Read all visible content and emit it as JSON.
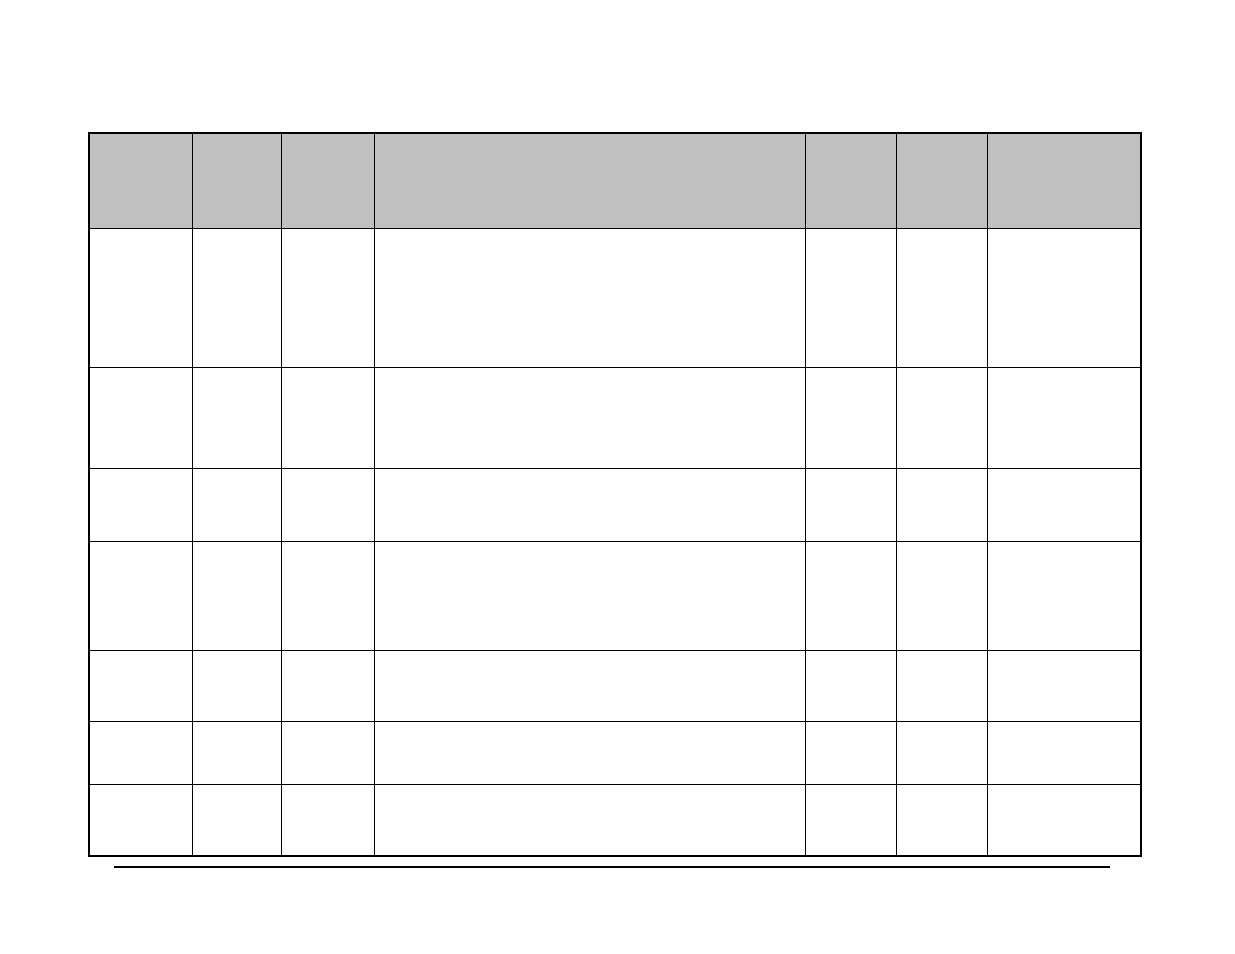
{
  "table": {
    "headers": [
      "",
      "",
      "",
      "",
      "",
      "",
      ""
    ],
    "rows": [
      [
        "",
        "",
        "",
        "",
        "",
        "",
        ""
      ],
      [
        "",
        "",
        "",
        "",
        "",
        "",
        ""
      ],
      [
        "",
        "",
        "",
        "",
        "",
        "",
        ""
      ],
      [
        "",
        "",
        "",
        "",
        "",
        "",
        ""
      ],
      [
        "",
        "",
        "",
        "",
        "",
        "",
        ""
      ],
      [
        "",
        "",
        "",
        "",
        "",
        "",
        ""
      ],
      [
        "",
        "",
        "",
        "",
        "",
        "",
        ""
      ]
    ]
  }
}
